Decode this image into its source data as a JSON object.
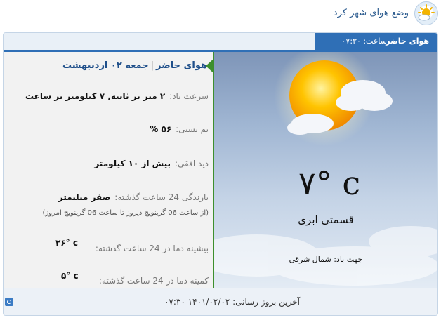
{
  "app": {
    "title": "وضع هوای شهر کرد"
  },
  "tabs": {
    "current_label": "هوای حاضر",
    "time": "ساعت: ۰۷:۳۰"
  },
  "current": {
    "heading_title": "هوای حاضر",
    "heading_date": "جمعه ۰۲ اردیبهشت",
    "wind_speed_label": "سرعت باد:",
    "wind_speed_value": "۲ متر بر ثانیه, ۷ کیلومتر بر ساعت",
    "humidity_label": "نم نسبی:",
    "humidity_value": "۵۶ %",
    "visibility_label": "دید افقی:",
    "visibility_value": "بیش از ۱۰ کیلومتر",
    "precip_label": "بارندگی 24 ساعت گذشته:",
    "precip_value": "صفر میلیمتر",
    "precip_note": "(از ساعت 06 گرینویچ دیروز تا ساعت 06 گرینویچ امروز)",
    "max_label": "بیشینه دما در 24 ساعت گذشته:",
    "max_value": "۲۶° c",
    "min_label": "کمینه دما در 24 ساعت گذشته:",
    "min_value": "۵° c",
    "temperature": "۷° c",
    "condition": "قسمتی ابری",
    "wind_direction": "جهت باد: شمال شرقی"
  },
  "footer": {
    "last_update": "آخرین بروز رسانی: ۱۴۰۱/۰۲/۰۲ ۰۷:۳۰"
  },
  "colors": {
    "accent": "#2f6fb6",
    "marker": "#3d8f2d",
    "sun": "#f6b800"
  },
  "icons": {
    "logo": "weather-logo-icon",
    "marker": "pointer-arrow-icon",
    "refresh": "refresh-icon"
  }
}
